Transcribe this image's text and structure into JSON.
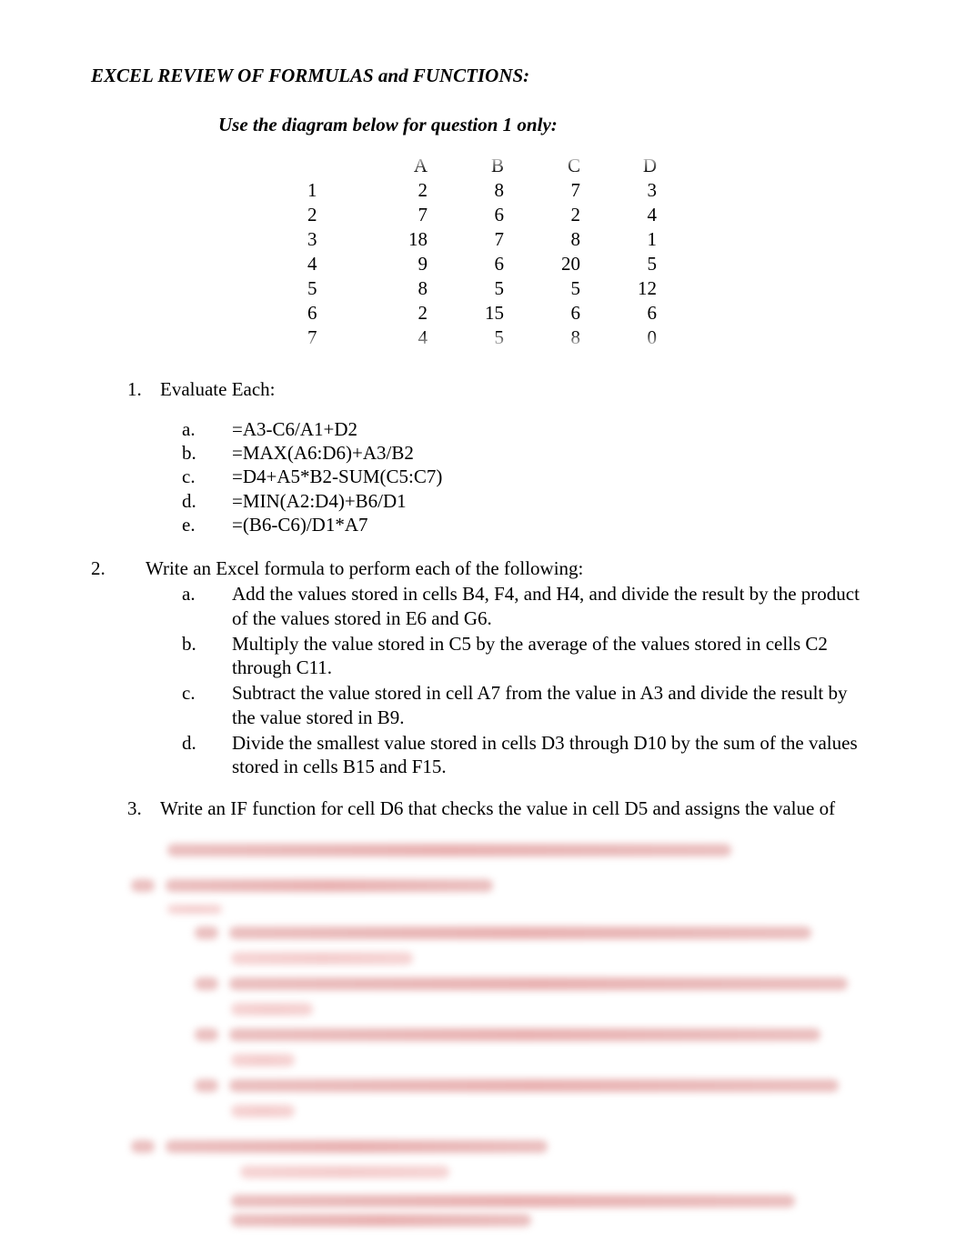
{
  "title": "EXCEL REVIEW OF FORMULAS and FUNCTIONS:",
  "caption": "Use the diagram below for question 1 only:",
  "grid": {
    "cols": [
      "A",
      "B",
      "C",
      "D"
    ],
    "rows": [
      "1",
      "2",
      "3",
      "4",
      "5",
      "6",
      "7"
    ],
    "cells": [
      [
        "2",
        "8",
        "7",
        "3"
      ],
      [
        "7",
        "6",
        "2",
        "4"
      ],
      [
        "18",
        "7",
        "8",
        "1"
      ],
      [
        "9",
        "6",
        "20",
        "5"
      ],
      [
        "8",
        "5",
        "5",
        "12"
      ],
      [
        "2",
        "15",
        "6",
        "6"
      ],
      [
        "4",
        "5",
        "8",
        "0"
      ]
    ]
  },
  "q1": {
    "num": "1.",
    "head": "Evaluate Each:",
    "items": [
      {
        "lab": "a.",
        "txt": "=A3-C6/A1+D2"
      },
      {
        "lab": "b.",
        "txt": "=MAX(A6:D6)+A3/B2"
      },
      {
        "lab": "c.",
        "txt": "=D4+A5*B2-SUM(C5:C7)"
      },
      {
        "lab": "d.",
        "txt": "=MIN(A2:D4)+B6/D1"
      },
      {
        "lab": "e.",
        "txt": "=(B6-C6)/D1*A7"
      }
    ]
  },
  "q2": {
    "num": "2.",
    "head": "Write an Excel formula to perform each of the following:",
    "items": [
      {
        "lab": "a.",
        "txt": "Add the values stored in cells B4, F4, and H4, and divide the result by the product of the values stored in E6 and G6."
      },
      {
        "lab": "b.",
        "txt": "Multiply the value stored in C5 by the average of the values stored in cells C2 through C11."
      },
      {
        "lab": "c.",
        "txt": "Subtract the value stored in cell A7 from the value in A3 and divide the result by the value stored in B9."
      },
      {
        "lab": "d.",
        "txt": "Divide the smallest value stored in cells D3 through D10 by the sum of the values stored in cells B15 and F15."
      }
    ]
  },
  "q3": {
    "num": "3.",
    "txt": "Write an IF function for cell D6 that checks the value in cell D5 and assigns the value of"
  }
}
